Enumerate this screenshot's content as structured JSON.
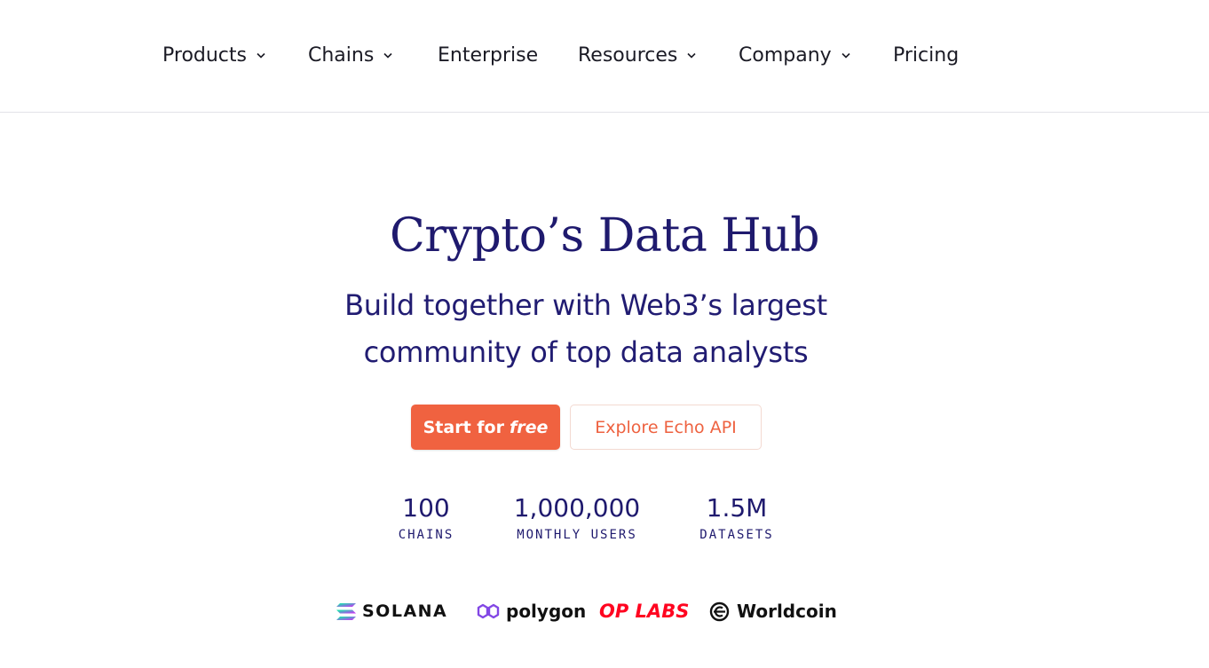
{
  "nav": {
    "items": [
      {
        "label": "Products",
        "dropdown": true
      },
      {
        "label": "Chains",
        "dropdown": true
      },
      {
        "label": "Enterprise",
        "dropdown": false
      },
      {
        "label": "Resources",
        "dropdown": true
      },
      {
        "label": "Company",
        "dropdown": true
      },
      {
        "label": "Pricing",
        "dropdown": false
      }
    ]
  },
  "hero": {
    "title": "Crypto’s Data Hub",
    "subtitle_line1": "Build together with Web3’s largest",
    "subtitle_line2": "community of top data analysts"
  },
  "cta": {
    "primary_prefix": "Start for",
    "primary_emph": "free",
    "secondary_label": "Explore Echo API"
  },
  "stats": [
    {
      "value": "100",
      "label": "CHAINS"
    },
    {
      "value": "1,000,000",
      "label": "MONTHLY USERS"
    },
    {
      "value": "1.5M",
      "label": "DATASETS"
    }
  ],
  "logos": [
    {
      "name": "SOLANA",
      "icon": "solana-icon"
    },
    {
      "name": "polygon",
      "icon": "polygon-icon"
    },
    {
      "name": "OP LABS",
      "icon": ""
    },
    {
      "name": "Worldcoin",
      "icon": "worldcoin-icon"
    }
  ],
  "colors": {
    "accent": "#f06240",
    "heading": "#1f1a6e",
    "op_red": "#ff0420",
    "polygon_purple": "#8247e5"
  }
}
